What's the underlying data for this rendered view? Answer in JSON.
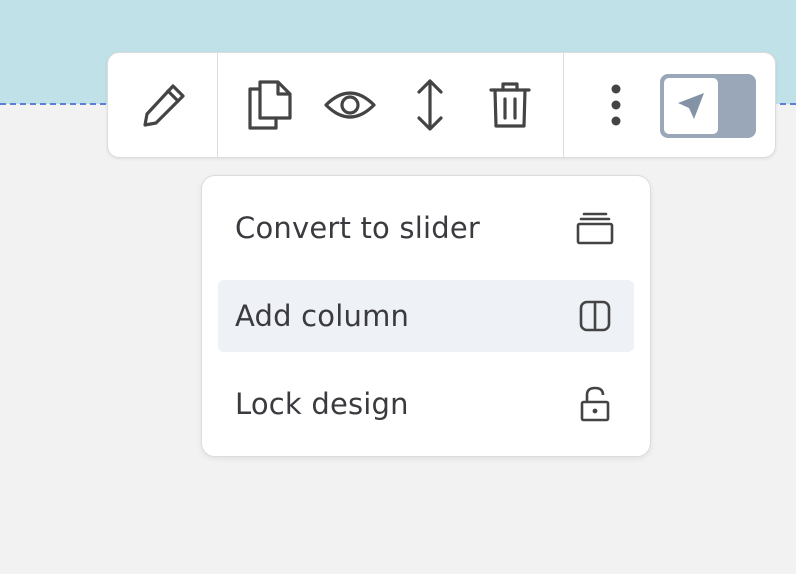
{
  "toolbar": {
    "buttons": [
      {
        "icon": "pencil-icon",
        "action": "edit"
      },
      {
        "icon": "duplicate-icon",
        "action": "duplicate"
      },
      {
        "icon": "eye-icon",
        "action": "toggle-visibility"
      },
      {
        "icon": "resize-vertical-icon",
        "action": "resize"
      },
      {
        "icon": "trash-icon",
        "action": "delete"
      },
      {
        "icon": "more-vertical-icon",
        "action": "more"
      }
    ],
    "toggle": {
      "icon": "navigation-arrow-icon",
      "state": "on"
    }
  },
  "menu": {
    "items": [
      {
        "label": "Convert to slider",
        "icon": "layers-stack-icon",
        "highlighted": false
      },
      {
        "label": "Add column",
        "icon": "split-column-icon",
        "highlighted": true
      },
      {
        "label": "Lock design",
        "icon": "unlock-icon",
        "highlighted": false
      }
    ]
  },
  "colors": {
    "header_band": "#c1e1e8",
    "selection_line": "#5b7fd6",
    "canvas_bg": "#f2f2f2",
    "toggle_bg": "#9aa7b9",
    "menu_highlight": "#eef1f6",
    "icon_color": "#444444"
  }
}
